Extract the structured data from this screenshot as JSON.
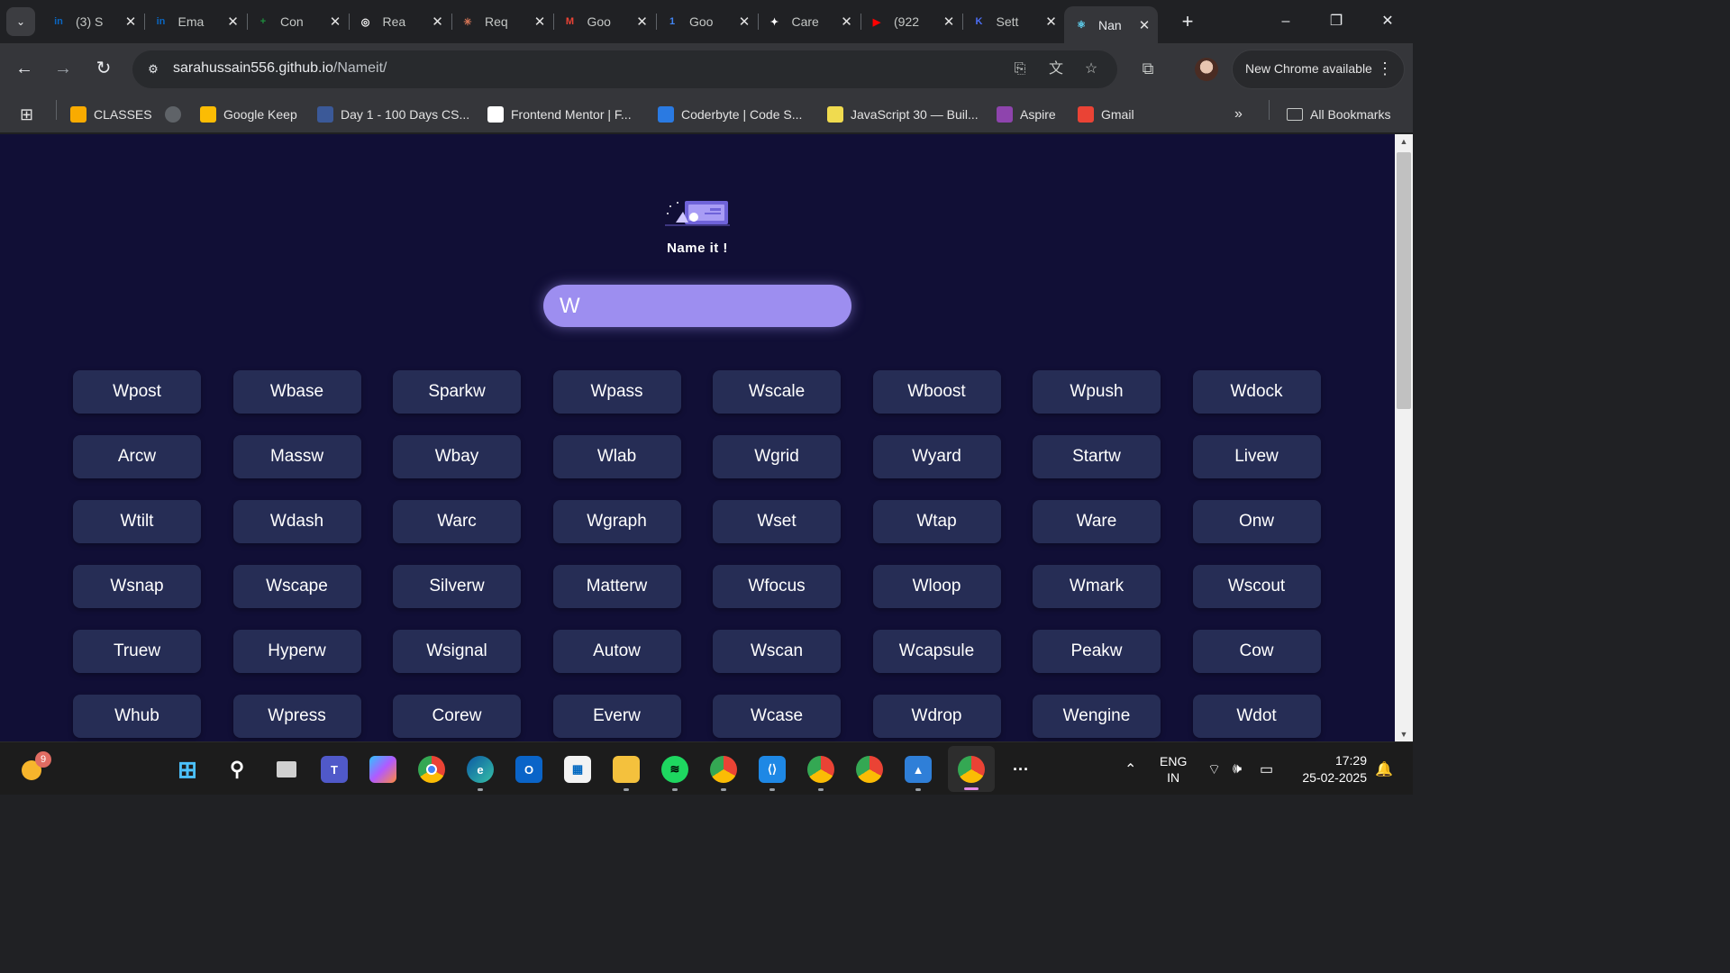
{
  "tabs": [
    {
      "title": "(3) S",
      "favicon": "linkedin-icon",
      "color": "#0a66c2",
      "glyph": "in"
    },
    {
      "title": "Ema",
      "favicon": "linkedin-icon",
      "color": "#0a66c2",
      "glyph": "in"
    },
    {
      "title": "Con",
      "favicon": "plus-circle-icon",
      "color": "#1e8e3e",
      "glyph": "+"
    },
    {
      "title": "Rea",
      "favicon": "openai-icon",
      "color": "#ffffff",
      "glyph": "◎"
    },
    {
      "title": "Req",
      "favicon": "claude-icon",
      "color": "#d97757",
      "glyph": "✳"
    },
    {
      "title": "Goo",
      "favicon": "gmail-icon",
      "color": "#ea4335",
      "glyph": "M"
    },
    {
      "title": "Goo",
      "favicon": "google-icon",
      "color": "#4285f4",
      "glyph": "1"
    },
    {
      "title": "Care",
      "favicon": "sparkle-icon",
      "color": "#ffffff",
      "glyph": "✦"
    },
    {
      "title": "(922",
      "favicon": "youtube-icon",
      "color": "#ff0000",
      "glyph": "▶"
    },
    {
      "title": "Sett",
      "favicon": "settings-app-icon",
      "color": "#4c6ef5",
      "glyph": "K"
    },
    {
      "title": "Nan",
      "favicon": "react-icon",
      "color": "#61dafb",
      "glyph": "⚛"
    }
  ],
  "window_controls": {
    "minimize": "–",
    "restore": "❐",
    "close": "✕"
  },
  "toolbar": {
    "url_host": "sarahussain556.github.io",
    "url_path": "/Nameit/",
    "update_label": "New Chrome available"
  },
  "bookmarks": [
    {
      "label": "CLASSES",
      "icon": "classroom-icon",
      "color": "#f9ab00"
    },
    {
      "label": "",
      "icon": "globe-icon",
      "color": "#5f6368"
    },
    {
      "label": "Google Keep",
      "icon": "keep-icon",
      "color": "#fbbc04"
    },
    {
      "label": "Day 1 - 100 Days CS...",
      "icon": "bookmark-square-icon",
      "color": "#3b5998"
    },
    {
      "label": "Frontend Mentor | F...",
      "icon": "frontend-mentor-icon",
      "color": "#ffffff"
    },
    {
      "label": "Coderbyte | Code S...",
      "icon": "coderbyte-icon",
      "color": "#2a7ae2"
    },
    {
      "label": "JavaScript 30 — Buil...",
      "icon": "js30-icon",
      "color": "#f0db4f"
    },
    {
      "label": "Aspire",
      "icon": "aspire-icon",
      "color": "#8e44ad"
    },
    {
      "label": "Gmail",
      "icon": "gmail-icon",
      "color": "#ea4335"
    }
  ],
  "bookmarks_more": "»",
  "all_bookmarks_label": "All Bookmarks",
  "app": {
    "title": "Name it !",
    "search_value": "W",
    "names": [
      "Wpost",
      "Wbase",
      "Sparkw",
      "Wpass",
      "Wscale",
      "Wboost",
      "Wpush",
      "Wdock",
      "Arcw",
      "Massw",
      "Wbay",
      "Wlab",
      "Wgrid",
      "Wyard",
      "Startw",
      "Livew",
      "Wtilt",
      "Wdash",
      "Warc",
      "Wgraph",
      "Wset",
      "Wtap",
      "Ware",
      "Onw",
      "Wsnap",
      "Wscape",
      "Silverw",
      "Matterw",
      "Wfocus",
      "Wloop",
      "Wmark",
      "Wscout",
      "Truew",
      "Hyperw",
      "Wsignal",
      "Autow",
      "Wscan",
      "Wcapsule",
      "Peakw",
      "Cow",
      "Whub",
      "Wpress",
      "Corew",
      "Everw",
      "Wcase",
      "Wdrop",
      "Wengine",
      "Wdot"
    ]
  },
  "taskbar": {
    "weather_badge": "9",
    "lang_line1": "ENG",
    "lang_line2": "IN",
    "time": "17:29",
    "date": "25-02-2025",
    "overflow": "···"
  }
}
